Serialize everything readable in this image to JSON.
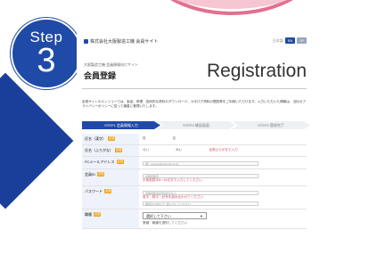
{
  "step": {
    "label": "Step",
    "number": "3"
  },
  "header": {
    "company": "株式会社大阪製造工機 会員サイト",
    "lang_jp": "日本語",
    "lang_buttons": [
      "EN",
      "JP"
    ]
  },
  "hero": {
    "breadcrumb": "大阪製造工機 会員情報向けサイト",
    "title_jp": "会員登録",
    "title_en": "Registration"
  },
  "intro": "会員サイトのエントリーでは、製品、修理、技術的な資料のダウンロード、カタログ資料の閲覧等をご利用いただけます。入力いただいた情報は、当社のプライバシーポリシーに従って厳重に管理いたします。",
  "steps": [
    "STEP1 会員情報入力",
    "STEP2 確認画面",
    "STEP3 登録完了"
  ],
  "form": {
    "rows": [
      {
        "label": "氏名（漢字）",
        "required": "必須",
        "left": "姓",
        "right": "名",
        "hint": ""
      },
      {
        "label": "氏名（ふりがな）",
        "required": "必須",
        "left": "せい",
        "right": "めい",
        "hint": "全角ひらがなで入力"
      },
      {
        "label": "PCメールアドレス",
        "required": "必須",
        "left": "",
        "right": "",
        "hint": ""
      },
      {
        "label": "会員ID",
        "required": "必須",
        "left": "",
        "right": "",
        "hint": "半角英数字8〜16文字で入力してください"
      },
      {
        "label": "パスワード",
        "required": "必須",
        "left": "",
        "right": "",
        "hint": "英字・数字・記号を組み合わせてください"
      },
      {
        "label": "職種",
        "required": "必須",
        "left": "",
        "right": "",
        "hint": ""
      }
    ],
    "email_placeholder": "例）sample@example.co.jp",
    "id_placeholder": "半角英数字",
    "password_note": "半角英数字記号8文字以上",
    "password_confirm": "確認のためもう一度入力してください",
    "select_value": "選択して下さい",
    "select_note": "業種・職種を選択してください"
  }
}
